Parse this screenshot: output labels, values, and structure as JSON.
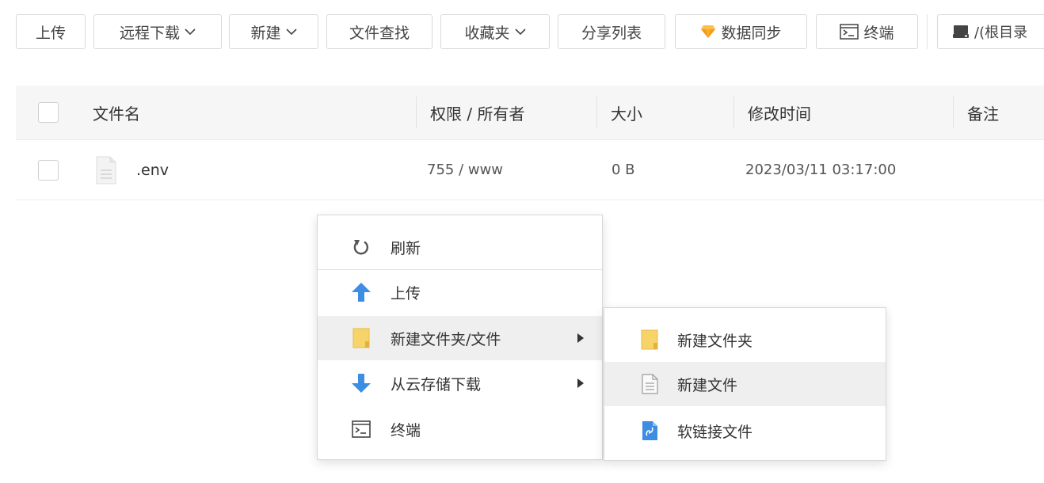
{
  "toolbar": {
    "upload": "上传",
    "remote_download": "远程下载",
    "new": "新建",
    "file_search": "文件查找",
    "favorites": "收藏夹",
    "share_list": "分享列表",
    "data_sync": "数据同步",
    "terminal": "终端",
    "path": "/(根目录"
  },
  "table": {
    "headers": {
      "name": "文件名",
      "permission": "权限 / 所有者",
      "size": "大小",
      "modified": "修改时间",
      "note": "备注"
    },
    "rows": [
      {
        "name": ".env",
        "permission": "755 / www",
        "size": "0 B",
        "modified": "2023/03/11 03:17:00",
        "note": ""
      }
    ]
  },
  "context_menu": {
    "items": [
      {
        "label": "刷新",
        "icon": "refresh-icon"
      },
      {
        "label": "上传",
        "icon": "upload-arrow-icon"
      },
      {
        "label": "新建文件夹/文件",
        "icon": "folder-icon",
        "has_submenu": true,
        "highlighted": true
      },
      {
        "label": "从云存储下载",
        "icon": "download-arrow-icon",
        "has_submenu": true
      },
      {
        "label": "终端",
        "icon": "terminal-icon"
      }
    ]
  },
  "submenu": {
    "items": [
      {
        "label": "新建文件夹",
        "icon": "folder-icon"
      },
      {
        "label": "新建文件",
        "icon": "file-icon",
        "highlighted": true
      },
      {
        "label": "软链接文件",
        "icon": "link-file-icon"
      }
    ]
  },
  "colors": {
    "accent_blue": "#3d8ee3",
    "folder_yellow": "#f7d469",
    "gem_orange": "#f59a1c",
    "highlight_bg": "#efefef"
  }
}
